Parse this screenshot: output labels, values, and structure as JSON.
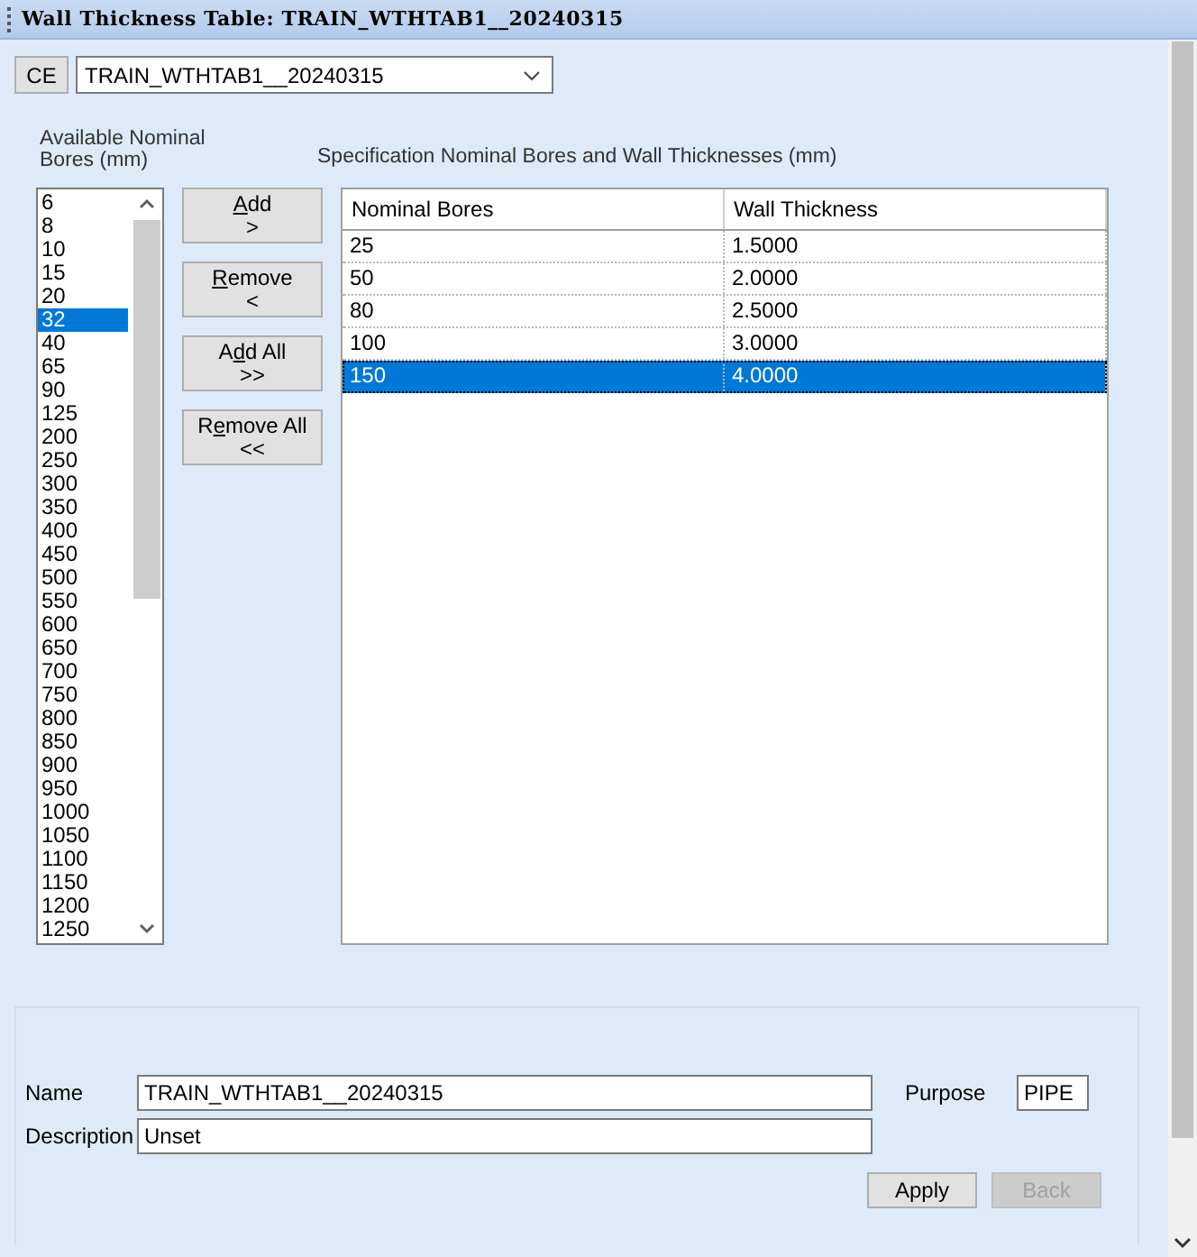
{
  "window": {
    "title": "Wall Thickness Table: TRAIN_WTHTAB1__20240315"
  },
  "ce_button": {
    "label": "CE"
  },
  "table_select": {
    "value": "TRAIN_WTHTAB1__20240315"
  },
  "available": {
    "label": "Available Nominal Bores (mm)",
    "items": [
      {
        "label": "6",
        "selected": false
      },
      {
        "label": "8",
        "selected": false
      },
      {
        "label": "10",
        "selected": false
      },
      {
        "label": "15",
        "selected": false
      },
      {
        "label": "20",
        "selected": false
      },
      {
        "label": "32",
        "selected": true
      },
      {
        "label": "40",
        "selected": false
      },
      {
        "label": "65",
        "selected": false
      },
      {
        "label": "90",
        "selected": false
      },
      {
        "label": "125",
        "selected": false
      },
      {
        "label": "200",
        "selected": false
      },
      {
        "label": "250",
        "selected": false
      },
      {
        "label": "300",
        "selected": false
      },
      {
        "label": "350",
        "selected": false
      },
      {
        "label": "400",
        "selected": false
      },
      {
        "label": "450",
        "selected": false
      },
      {
        "label": "500",
        "selected": false
      },
      {
        "label": "550",
        "selected": false
      },
      {
        "label": "600",
        "selected": false
      },
      {
        "label": "650",
        "selected": false
      },
      {
        "label": "700",
        "selected": false
      },
      {
        "label": "750",
        "selected": false
      },
      {
        "label": "800",
        "selected": false
      },
      {
        "label": "850",
        "selected": false
      },
      {
        "label": "900",
        "selected": false
      },
      {
        "label": "950",
        "selected": false
      },
      {
        "label": "1000",
        "selected": false
      },
      {
        "label": "1050",
        "selected": false
      },
      {
        "label": "1100",
        "selected": false
      },
      {
        "label": "1150",
        "selected": false
      },
      {
        "label": "1200",
        "selected": false
      },
      {
        "label": "1250",
        "selected": false
      }
    ]
  },
  "transfer_buttons": [
    {
      "label_parts": [
        {
          "text": "A",
          "underlined": true
        },
        {
          "text": "dd",
          "underlined": false
        }
      ],
      "symbol": ">"
    },
    {
      "label_parts": [
        {
          "text": "R",
          "underlined": true
        },
        {
          "text": "emove",
          "underlined": false
        }
      ],
      "symbol": "<"
    },
    {
      "label_parts": [
        {
          "text": "A",
          "underlined": false
        },
        {
          "text": "d",
          "underlined": true
        },
        {
          "text": "d All",
          "underlined": false
        }
      ],
      "symbol": ">>"
    },
    {
      "label_parts": [
        {
          "text": "R",
          "underlined": false
        },
        {
          "text": "e",
          "underlined": true
        },
        {
          "text": "move All",
          "underlined": false
        }
      ],
      "symbol": "<<"
    }
  ],
  "spec_table": {
    "label": "Specification Nominal Bores and Wall Thicknesses (mm)",
    "columns": [
      "Nominal Bores",
      "Wall Thickness"
    ],
    "rows": [
      {
        "cells": [
          "25",
          "1.5000"
        ],
        "selected": false
      },
      {
        "cells": [
          "50",
          "2.0000"
        ],
        "selected": false
      },
      {
        "cells": [
          "80",
          "2.5000"
        ],
        "selected": false
      },
      {
        "cells": [
          "100",
          "3.0000"
        ],
        "selected": false
      },
      {
        "cells": [
          "150",
          "4.0000"
        ],
        "selected": true
      }
    ]
  },
  "form": {
    "name_label": "Name",
    "name_value": "TRAIN_WTHTAB1__20240315",
    "purpose_label": "Purpose",
    "purpose_value": "PIPE",
    "description_label": "Description",
    "description_value": "Unset"
  },
  "buttons": [
    {
      "label": "Apply",
      "disabled": false
    },
    {
      "label": "Back",
      "disabled": true
    }
  ]
}
